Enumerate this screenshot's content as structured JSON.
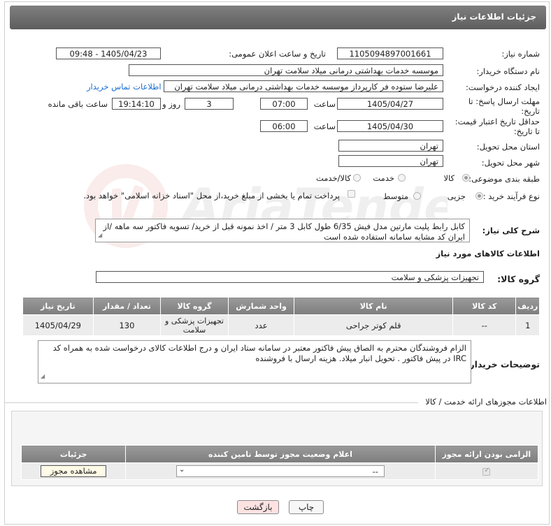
{
  "header": {
    "title": "جزئیات اطلاعات نیاز"
  },
  "need_number": {
    "label": "شماره نیاز:",
    "value": "1105094897001661"
  },
  "announce_datetime": {
    "label": "تاریخ و ساعت اعلان عمومی:",
    "value": "1405/04/23 - 09:48"
  },
  "buyer_org": {
    "label": "نام دستگاه خریدار:",
    "value": "موسسه خدمات بهداشتی درمانی میلاد سلامت تهران"
  },
  "requester": {
    "label": "ایجاد کننده درخواست:",
    "value": "علیرضا ستوده فر کارپرداز موسسه خدمات بهداشتی درمانی میلاد سلامت تهران",
    "contact_link": "اطلاعات تماس خریدار"
  },
  "reply_deadline": {
    "label_line1": "مهلت ارسال پاسخ: تا",
    "label_line2": "تاریخ:",
    "date": "1405/04/27",
    "time_label": "ساعت",
    "time": "07:00",
    "days": "3",
    "days_label": "روز و",
    "remaining": "19:14:10",
    "remaining_label": "ساعت باقی مانده"
  },
  "price_validity": {
    "label_line1": "حداقل تاریخ اعتبار قیمت:",
    "label_line2": "تا تاریخ:",
    "date": "1405/04/30",
    "time_label": "ساعت",
    "time": "06:00"
  },
  "province": {
    "label": "استان محل تحویل:",
    "value": "تهران"
  },
  "city": {
    "label": "شهر محل تحویل:",
    "value": "تهران"
  },
  "category": {
    "label": "طبقه بندی موضوعی:",
    "options": [
      "کالا",
      "خدمت",
      "کالا/خدمت"
    ],
    "selected": "کالا"
  },
  "process_type": {
    "label": "نوع فرآیند خرید :",
    "options": [
      "جزیی",
      "متوسط"
    ],
    "selected": "جزیی",
    "payment_note": "پرداخت تمام یا بخشی از مبلغ خرید،از محل \"اسناد خزانه اسلامی\" خواهد بود."
  },
  "description": {
    "label": "شرح کلی نیاز:",
    "text": "کابل رابط پلیت مارتین مدل فیش 6/35 طول کابل 3 متر / اخذ نمونه قبل از خرید/ تسویه فاکتور سه ماهه /از ایران کد مشابه سامانه استفاده شده است"
  },
  "goods_section": {
    "title": "اطلاعات کالاهای مورد نیاز"
  },
  "goods_group": {
    "label": "گروه کالا:",
    "value": "تجهیزات پزشکی و سلامت"
  },
  "goods_table": {
    "headers": [
      "ردیف",
      "کد کالا",
      "نام کالا",
      "واحد شمارش",
      "گروه کالا",
      "تعداد / مقدار",
      "تاریخ نیاز"
    ],
    "rows": [
      [
        "1",
        "--",
        "قلم کوتر جراحی",
        "عدد",
        "تجهیزات پزشکی و سلامت",
        "130",
        "1405/04/29"
      ]
    ]
  },
  "buyer_notes": {
    "label": "توضیحات خریدار:",
    "text": "الزام فروشندگان محترم به الصاق پیش فاکتور معتبر در سامانه ستاد ایران و درج اطلاعات کالای درخواست شده به همراه کد IRC  در پیش فاکتور . تحویل انبار میلاد. هزینه ارسال با فروشنده"
  },
  "licenses_section": {
    "title": "اطلاعات مجوزهای ارائه خدمت / کالا"
  },
  "licenses_table": {
    "headers": [
      "الزامی بودن ارائه مجوز",
      "اعلام وضعیت مجوز توسط تامین کننده",
      "جزئیات"
    ],
    "select_value": "--",
    "view_button": "مشاهده مجوز"
  },
  "buttons": {
    "print": "چاپ",
    "back": "بازگشت"
  },
  "watermark_text": "AriaTender.neT"
}
